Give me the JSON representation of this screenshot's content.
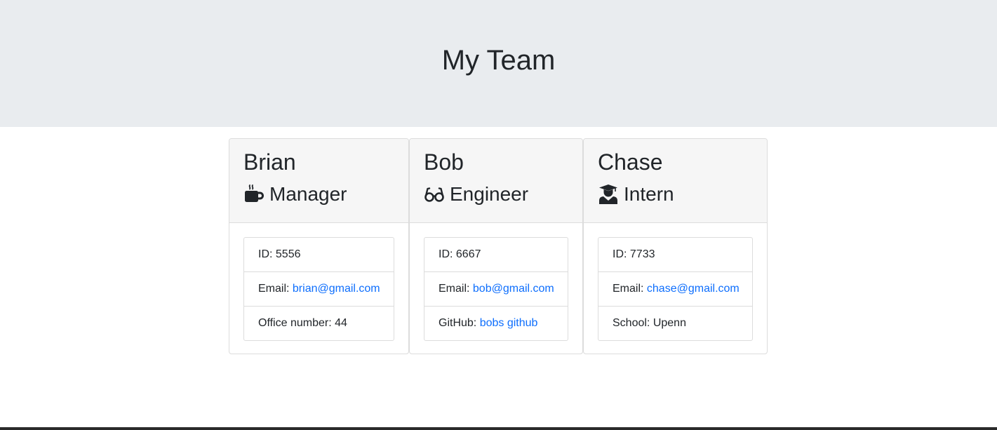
{
  "header": {
    "title": "My Team"
  },
  "cards": [
    {
      "name": "Brian",
      "role": "Manager",
      "role_icon": "coffee-mug-icon",
      "id_label": "ID: 5556",
      "email_label": "Email: ",
      "email": "brian@gmail.com",
      "extra_label": "Office number: 44",
      "extra_link": ""
    },
    {
      "name": "Bob",
      "role": "Engineer",
      "role_icon": "glasses-icon",
      "id_label": "ID: 6667",
      "email_label": "Email: ",
      "email": "bob@gmail.com",
      "extra_label": "GitHub: ",
      "extra_link": "bobs github"
    },
    {
      "name": "Chase",
      "role": "Intern",
      "role_icon": "graduate-icon",
      "id_label": "ID: 7733",
      "email_label": "Email: ",
      "email": "chase@gmail.com",
      "extra_label": "School: Upenn",
      "extra_link": ""
    }
  ],
  "colors": {
    "jumbotron_bg": "#e9ecef",
    "card_header_bg": "#f6f6f6",
    "link": "#0d6efd",
    "text": "#212529"
  }
}
